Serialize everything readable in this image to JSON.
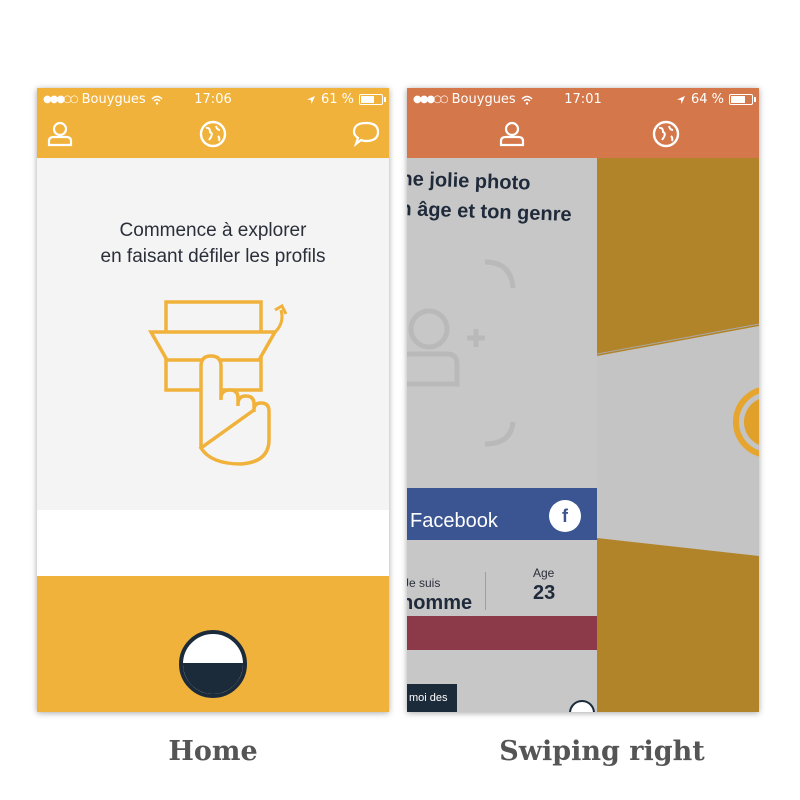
{
  "colors": {
    "home_accent": "#f0b23a",
    "swipe_accent": "#d4774a",
    "navy": "#1b2b3a",
    "facebook_blue": "#3b5592",
    "dark_gold": "#b2842a"
  },
  "home": {
    "status": {
      "carrier": "Bouygues",
      "time": "17:06",
      "battery": "61 %",
      "battery_level": 0.61
    },
    "nav": {
      "left_icon": "profile-icon",
      "center_icon": "globe-icon",
      "right_icon": "chat-icon"
    },
    "prompt_line1": "Commence à explorer",
    "prompt_line2": "en faisant défiler les profils",
    "illustration_icon": "swipe-hand-icon",
    "caption": "Home"
  },
  "swipe": {
    "status": {
      "carrier": "Bouygues",
      "time": "17:01",
      "battery": "64 %",
      "battery_level": 0.64
    },
    "nav": {
      "left_icon": "profile-icon",
      "center_icon": "globe-icon"
    },
    "msg_line1": "ne jolie photo",
    "msg_line2": "n âge et ton genre",
    "add_photo_icon": "add-user-icon",
    "facebook_label": "Facebook",
    "facebook_icon": "f",
    "gender_label": "Je suis",
    "gender_value": "homme",
    "age_label": "Age",
    "age_value": "23",
    "small_button_label": "moi des",
    "caption": "Swiping right"
  }
}
